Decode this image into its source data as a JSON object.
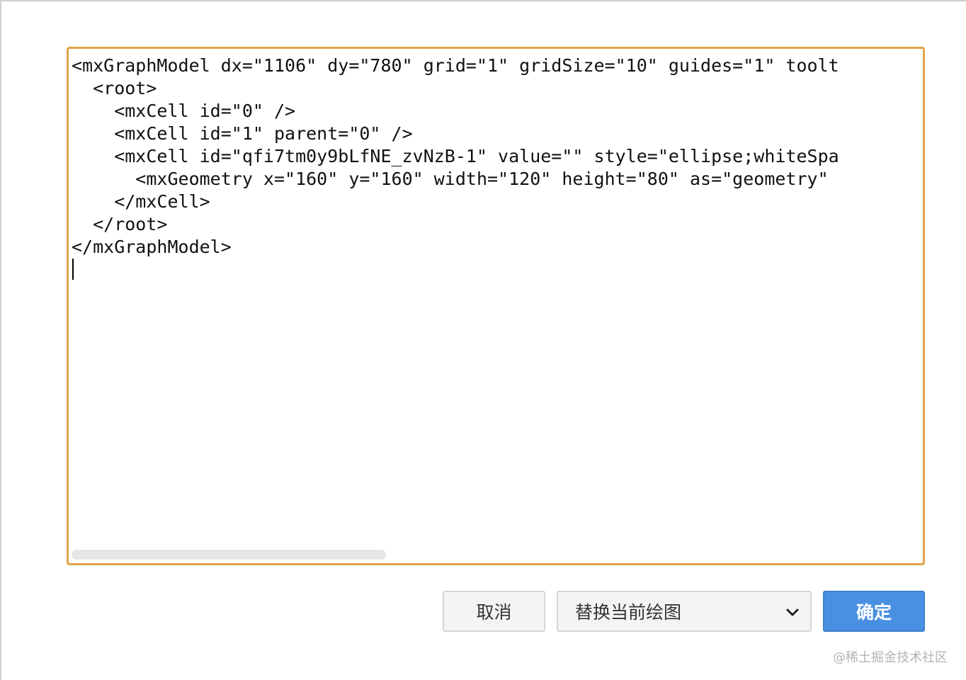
{
  "editor": {
    "lines": [
      "<mxGraphModel dx=\"1106\" dy=\"780\" grid=\"1\" gridSize=\"10\" guides=\"1\" toolt",
      "  <root>",
      "    <mxCell id=\"0\" />",
      "    <mxCell id=\"1\" parent=\"0\" />",
      "    <mxCell id=\"qfi7tm0y9bLfNE_zvNzB-1\" value=\"\" style=\"ellipse;whiteSpa",
      "      <mxGeometry x=\"160\" y=\"160\" width=\"120\" height=\"80\" as=\"geometry\"",
      "    </mxCell>",
      "  </root>",
      "</mxGraphModel>"
    ]
  },
  "buttons": {
    "cancel_label": "取消",
    "ok_label": "确定"
  },
  "mode_select": {
    "selected": "替换当前绘图"
  },
  "watermark": "@稀土掘金技术社区",
  "colors": {
    "editor_border": "#e0a445",
    "primary_button": "#4a90e2",
    "button_bg": "#f4f4f4"
  }
}
